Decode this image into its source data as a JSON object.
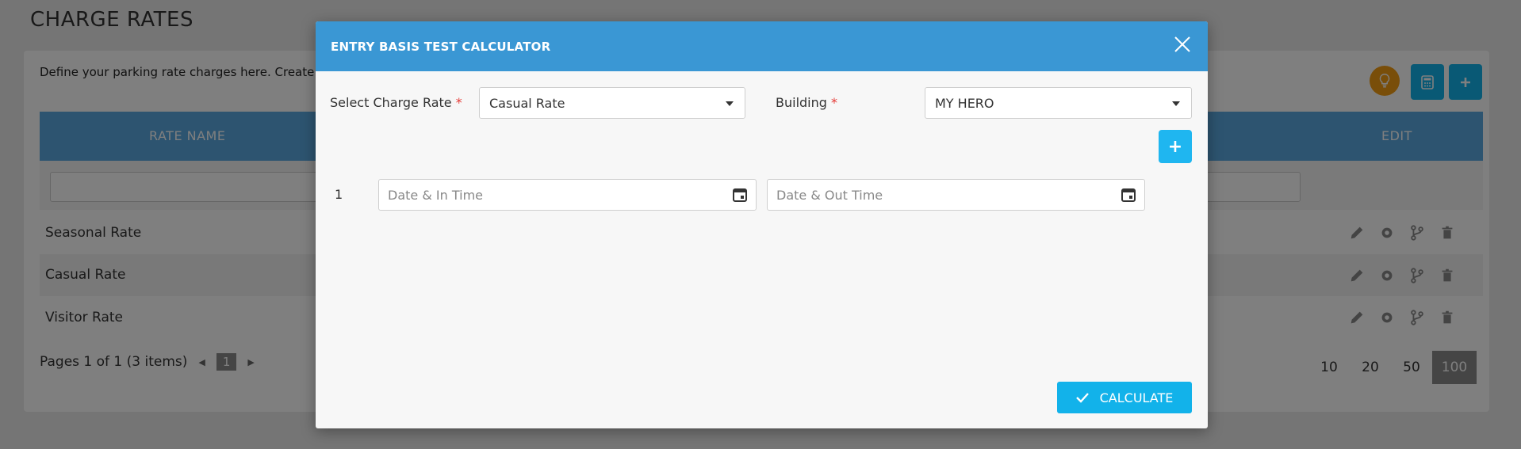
{
  "page": {
    "title": "CHARGE RATES",
    "description": "Define your parking rate charges here. Create m"
  },
  "table": {
    "columns": [
      "RATE NAME",
      "EDIT"
    ],
    "rows": [
      {
        "name": "Seasonal Rate"
      },
      {
        "name": "Casual Rate"
      },
      {
        "name": "Visitor Rate"
      }
    ],
    "pager_text": "Pages 1 of 1 (3 items)",
    "current_page": "1",
    "page_sizes": [
      "10",
      "20",
      "50",
      "100"
    ],
    "active_page_size": "100"
  },
  "modal": {
    "title": "ENTRY BASIS TEST CALCULATOR",
    "charge_rate_label": "Select Charge Rate",
    "charge_rate_value": "Casual Rate",
    "building_label": "Building",
    "building_value": "MY HERO",
    "required_mark": "*",
    "add_label": "+",
    "entry_number": "1",
    "date_in_placeholder": "Date & In Time",
    "date_out_placeholder": "Date & Out Time",
    "calculate_label": "CALCULATE"
  },
  "colors": {
    "header_blue": "#3a97d4",
    "action_cyan": "#12b2ea",
    "table_header": "#5aa8e0",
    "bulb_orange": "#f39c12",
    "required_red": "#e53935"
  },
  "icons": {
    "close": "close-icon",
    "calendar": "calendar-icon",
    "check": "check-icon",
    "calculator": "calculator-icon",
    "add": "plus-icon",
    "bulb": "lightbulb-icon",
    "edit": "pencil-icon",
    "settings": "gear-icon",
    "branch": "branch-icon",
    "delete": "trash-icon"
  }
}
